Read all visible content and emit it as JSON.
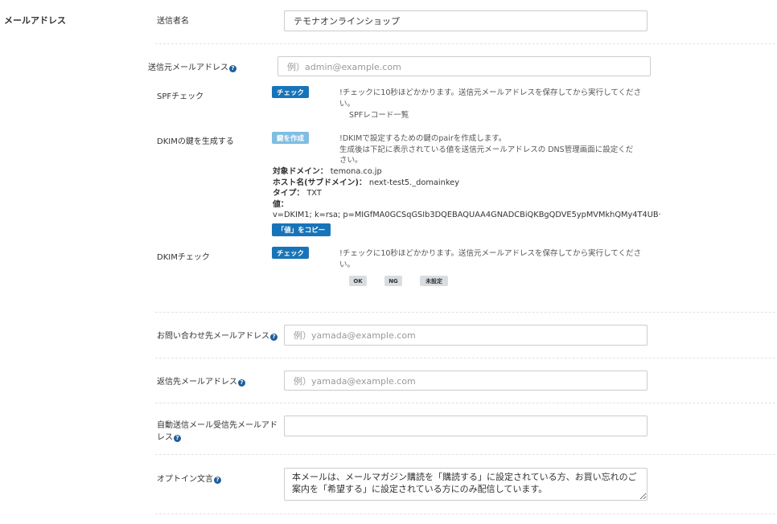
{
  "section": {
    "title": "メールアドレス"
  },
  "sender_name": {
    "label": "送信者名",
    "value": "テモナオンラインショップ"
  },
  "sender_email": {
    "label": "送信元メールアドレス",
    "placeholder": "例）admin@example.com"
  },
  "spf": {
    "label": "SPFチェック",
    "button": "チェック",
    "note_icon": "!",
    "note": "チェックに10秒ほどかかります。送信元メールアドレスを保存してから実行してください。",
    "link": "SPFレコード一覧"
  },
  "dkim_gen": {
    "label": "DKIMの鍵を生成する",
    "button": "鍵を作成",
    "note_icon": "!",
    "note_line1": "DKIMで設定するための鍵のpairを作成します。",
    "note_line2": "生成後は下記に表示されている値を送信元メールアドレスの DNS管理画面に設定ください。",
    "domain_key": "対象ドメイン：",
    "domain_value": "temona.co.jp",
    "host_key": "ホスト名(サブドメイン)：",
    "host_value": "next-test5._domainkey",
    "type_key": "タイプ：",
    "type_value": "TXT",
    "value_key": "値：",
    "value_value": "v=DKIM1; k=rsa; p=MIGfMA0GCSqGSIb3DQEBAQUAA4GNADCBiQKBgQDVE5ypMVMkhQMy4T4UB···",
    "copy_button": "「値」をコピー"
  },
  "dkim_check": {
    "label": "DKIMチェック",
    "button": "チェック",
    "note_icon": "!",
    "note": "チェックに10秒ほどかかります。送信元メールアドレスを保存してから実行してください。",
    "badges": [
      "OK",
      "NG",
      "未設定"
    ]
  },
  "inquiry_email": {
    "label": "お問い合わせ先メールアドレス",
    "placeholder": "例）yamada@example.com"
  },
  "reply_email": {
    "label": "返信先メールアドレス",
    "placeholder": "例）yamada@example.com"
  },
  "auto_email": {
    "label_line1": "自動送信メール受信先メールアド",
    "label_line2": "レス",
    "value": ""
  },
  "optin": {
    "label": "オプトイン文言",
    "value": "本メールは、メールマガジン購読を「購読する」に設定されている方、お買い忘れのご案内を「希望する」に設定されている方にのみ配信しています。"
  },
  "icons": {
    "help": "?",
    "help_icon": "question-circle-icon",
    "note_icon": "exclamation-circle-icon"
  },
  "colors": {
    "primary": "#1874b8",
    "primary_light": "#7fbde2",
    "help": "#1f5d9c",
    "badge": "#d8dde2"
  }
}
